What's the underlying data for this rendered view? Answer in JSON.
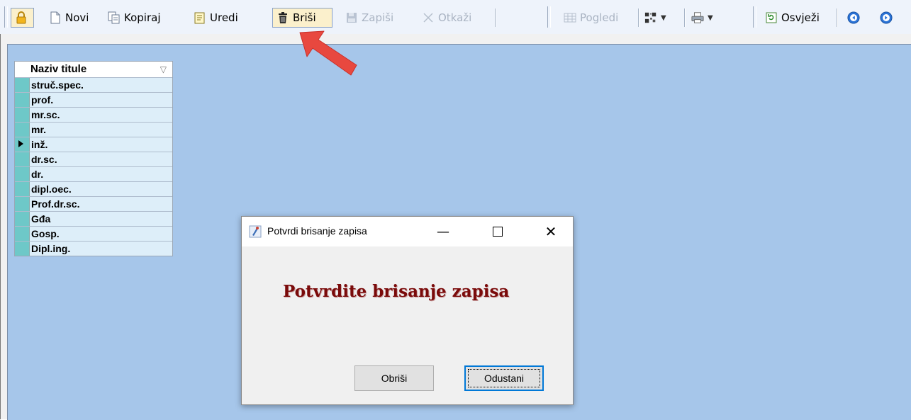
{
  "toolbar": {
    "buttons": {
      "novi": "Novi",
      "kopiraj": "Kopiraj",
      "uredi": "Uredi",
      "brisi": "Briši",
      "zapisi": "Zapiši",
      "otkazi": "Otkaži",
      "pogledi": "Pogledi",
      "osvjezi": "Osvježi"
    }
  },
  "grid": {
    "header": "Naziv titule",
    "rows": [
      "struč.spec.",
      "prof.",
      "mr.sc.",
      "mr.",
      "inž.",
      "dr.sc.",
      "dr.",
      "dipl.oec.",
      "Prof.dr.sc.",
      "Gđa",
      "Gosp.",
      "Dipl.ing."
    ],
    "current_row": "inž."
  },
  "dialog": {
    "title": "Potvrdi brisanje zapisa",
    "message": "Potvrdite brisanje zapisa",
    "confirm_label": "Obriši",
    "cancel_label": "Odustani"
  },
  "colors": {
    "workspace": "#a6c6ea",
    "message": "#7a0a0a",
    "arrow": "#e8483f"
  }
}
